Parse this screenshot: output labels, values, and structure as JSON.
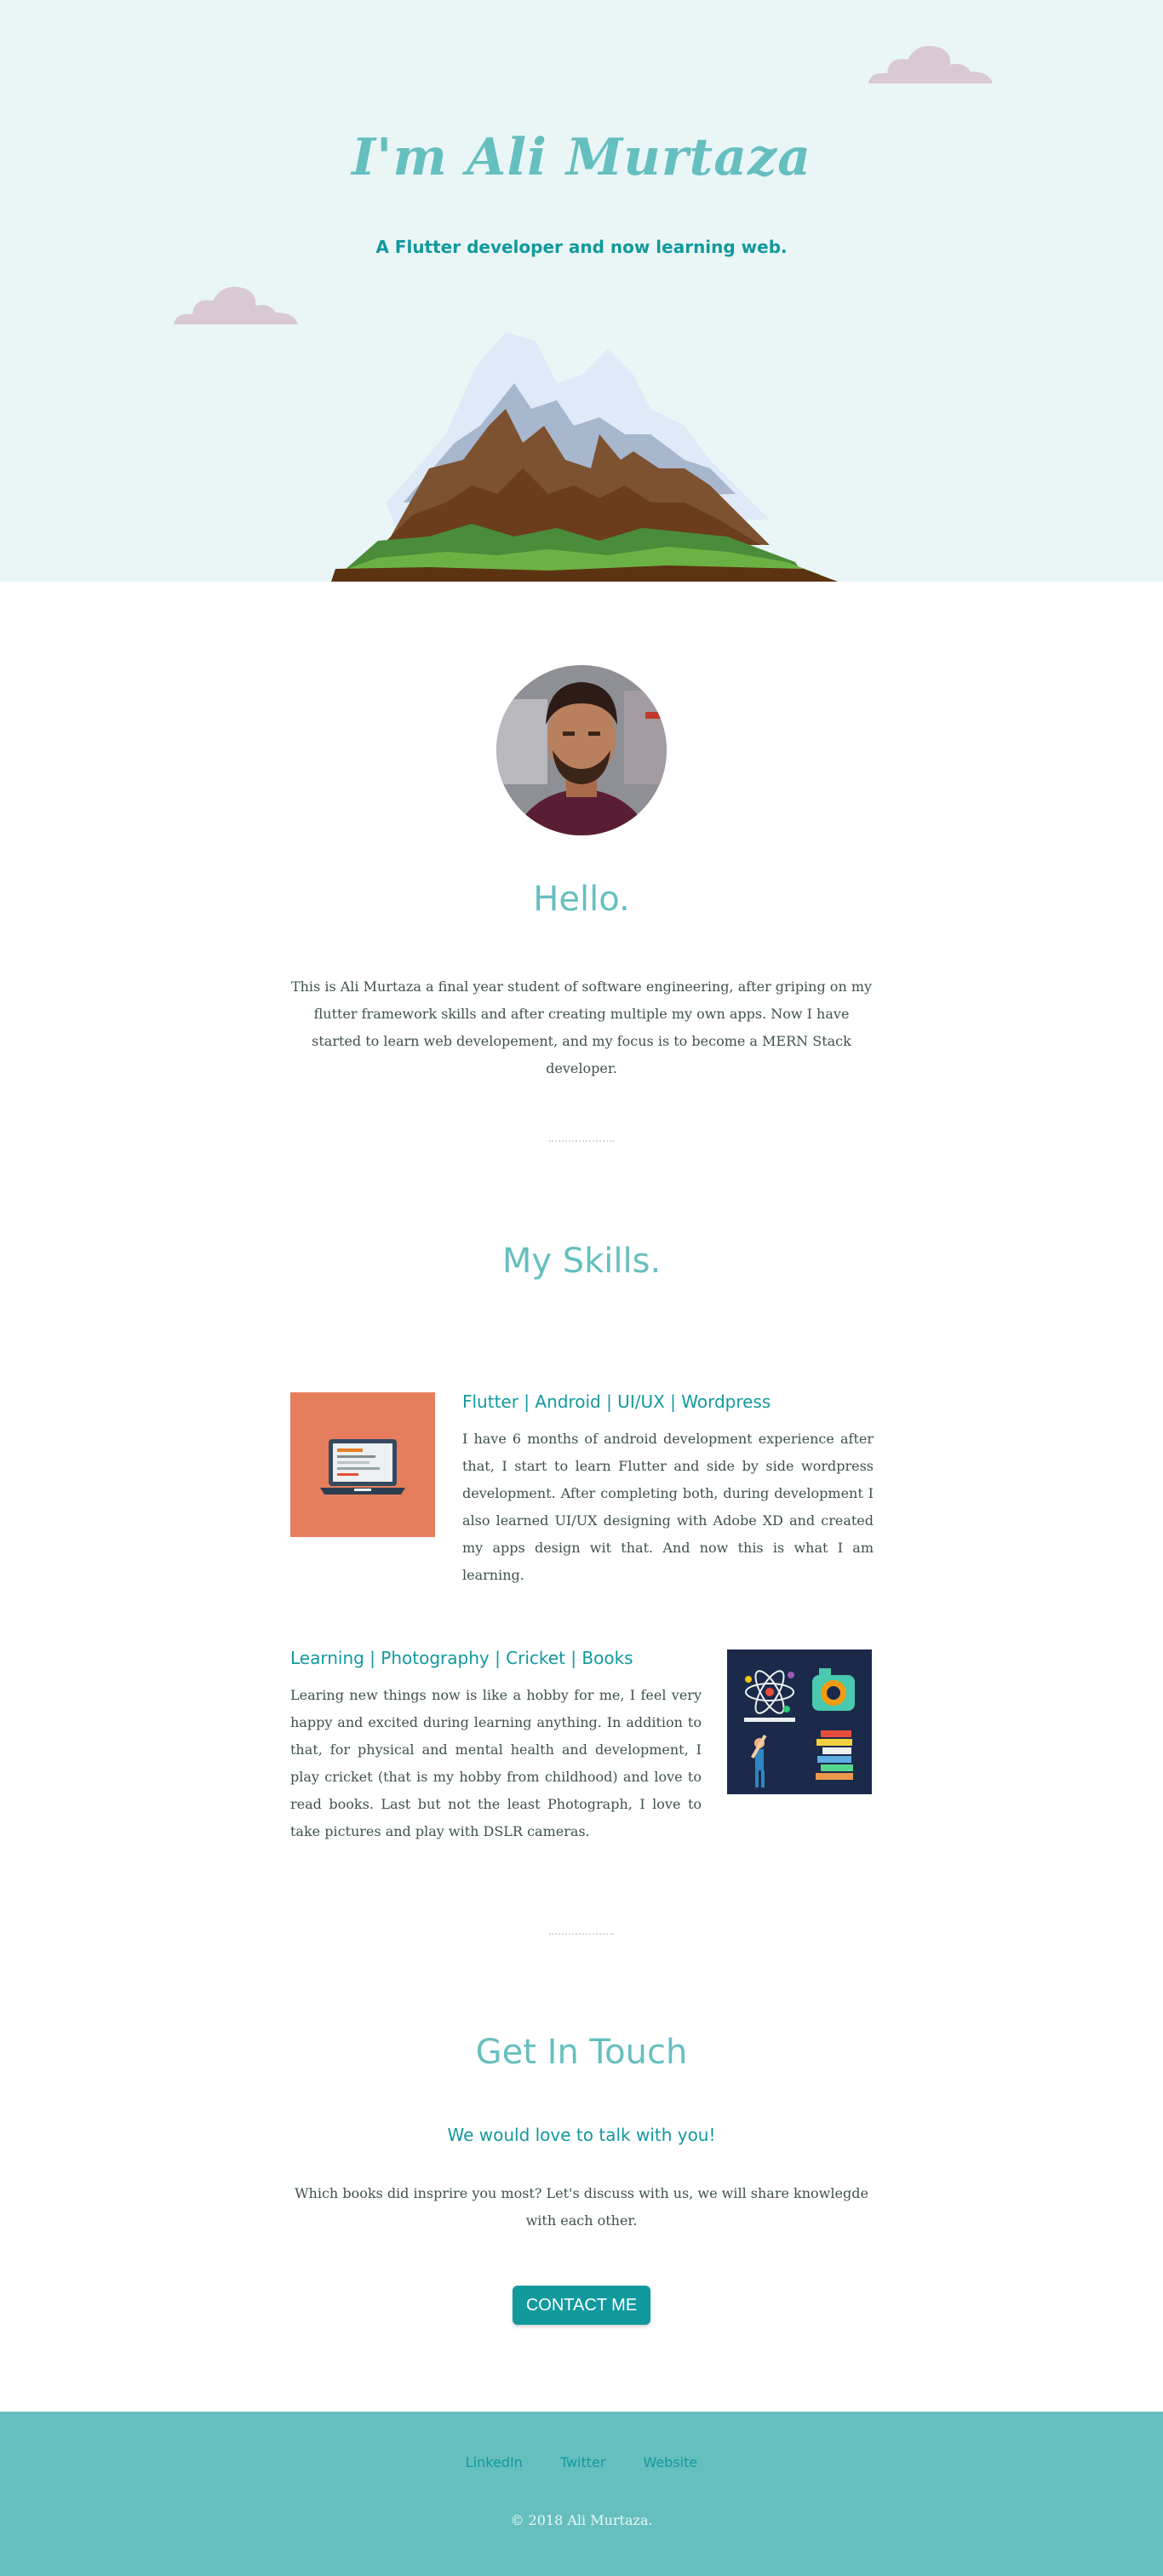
{
  "hero": {
    "title": "I'm Ali Murtaza",
    "subtitle": "A Flutter developer and now learning web."
  },
  "profile": {
    "greeting": "Hello.",
    "about": "This is Ali Murtaza a final year student of software engineering, after griping on my flutter framework skills and after creating multiple my own apps. Now I have started to learn web developement, and my focus is to become a MERN Stack developer."
  },
  "skills": {
    "heading": "My Skills.",
    "items": [
      {
        "title": "Flutter | Android | UI/UX | Wordpress",
        "text": "I have 6 months of android development experience after that, I start to learn Flutter and side by side wordpress development. After completing both, during development I also learned UI/UX designing with Adobe XD and created my apps design wit that. And now this is what I am learning."
      },
      {
        "title": "Learning | Photography | Cricket | Books",
        "text": "Learing new things now is like a hobby for me, I feel very happy and excited during learning anything. In addition to that, for physical and mental health and development, I play cricket (that is my hobby from childhood) and love to read books. Last but not the least Photograph, I love to take pictures and play with DSLR cameras."
      }
    ]
  },
  "contact": {
    "heading": "Get In Touch",
    "subheading": "We would love to talk with you!",
    "text": "Which books did insprire you most? Let's discuss with us, we will share knowlegde with each other.",
    "button_label": "CONTACT ME"
  },
  "footer": {
    "links": [
      "LinkedIn",
      "Twitter",
      "Website"
    ],
    "copyright": "© 2018 Ali Murtaza."
  },
  "colors": {
    "hero_bg": "#eaf6f6",
    "accent": "#66bfbf",
    "accent_dark": "#11999e",
    "text": "#40514e"
  }
}
